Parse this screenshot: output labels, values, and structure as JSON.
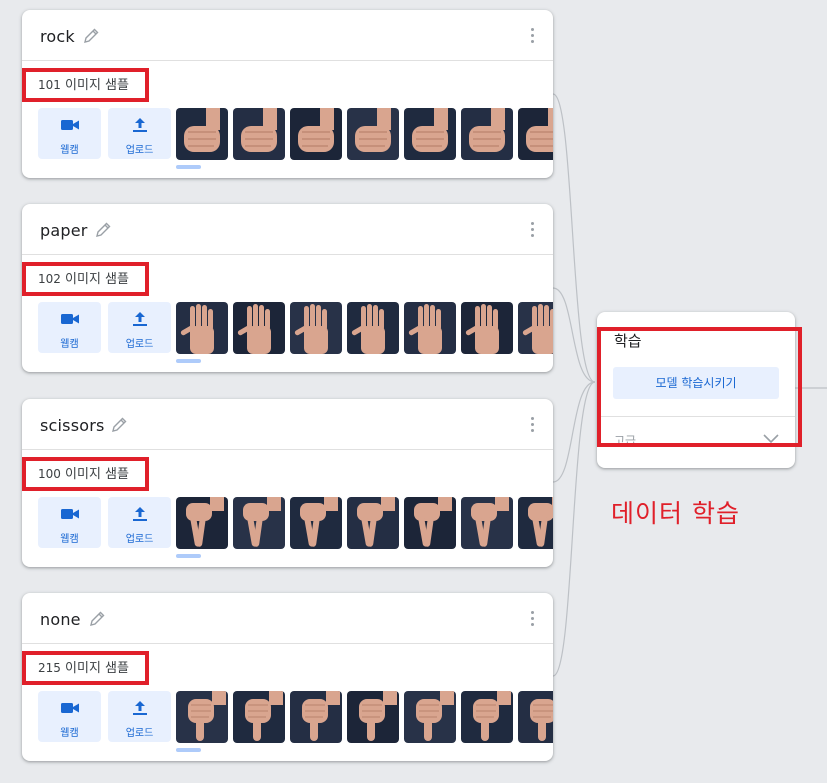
{
  "classes": [
    {
      "name": "rock",
      "samples_count": "101",
      "samples_label": "이미지 샘플",
      "thumb_kind": "fist"
    },
    {
      "name": "paper",
      "samples_count": "102",
      "samples_label": "이미지 샘플",
      "thumb_kind": "open"
    },
    {
      "name": "scissors",
      "samples_count": "100",
      "samples_label": "이미지 샘플",
      "thumb_kind": "vsign"
    },
    {
      "name": "none",
      "samples_count": "215",
      "samples_label": "이미지 샘플",
      "thumb_kind": "thumb"
    }
  ],
  "buttons": {
    "webcam": "웹캠",
    "upload": "업로드"
  },
  "training": {
    "title": "학습",
    "train_button": "모델 학습시키기",
    "advanced": "고급"
  },
  "annotation": "데이터 학습",
  "colors": {
    "highlight": "#e0202a",
    "accent": "#1967d2",
    "button_bg": "#e8f0fe",
    "canvas_bg": "#e8eaed"
  },
  "icons": {
    "webcam": "videocam-icon",
    "upload": "upload-icon",
    "edit": "pencil-icon",
    "menu": "more-vert-icon",
    "advanced": "chevron-down-icon"
  }
}
